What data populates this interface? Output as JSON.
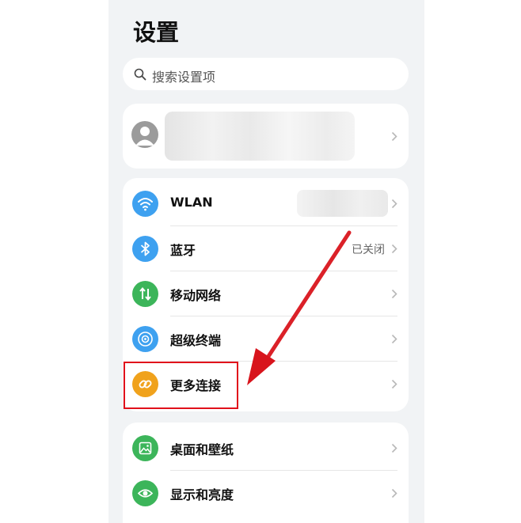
{
  "page_title": "设置",
  "search": {
    "placeholder": "搜索设置项",
    "icon": "search-icon"
  },
  "account": {
    "avatar_icon": "user-avatar-icon"
  },
  "section1": [
    {
      "label": "WLAN",
      "value": "",
      "icon": "wifi-icon",
      "color": "#3ea1f0"
    },
    {
      "label": "蓝牙",
      "value": "已关闭",
      "icon": "bluetooth-icon",
      "color": "#3ea1f0"
    },
    {
      "label": "移动网络",
      "value": "",
      "icon": "mobile-data-icon",
      "color": "#3cb55a"
    },
    {
      "label": "超级终端",
      "value": "",
      "icon": "super-device-icon",
      "color": "#3ea1f0"
    },
    {
      "label": "更多连接",
      "value": "",
      "icon": "link-icon",
      "color": "#f0a21c"
    }
  ],
  "section2": [
    {
      "label": "桌面和壁纸",
      "icon": "wallpaper-icon",
      "color": "#3cb55a"
    },
    {
      "label": "显示和亮度",
      "icon": "display-eye-icon",
      "color": "#3cb55a"
    }
  ],
  "annotation": {
    "color": "#e1101b"
  }
}
